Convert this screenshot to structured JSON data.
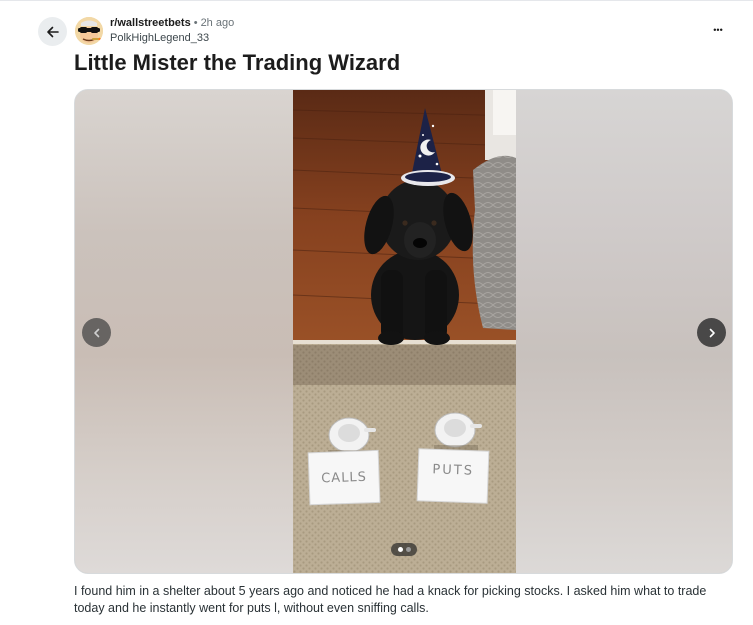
{
  "post": {
    "subreddit": "r/wallstreetbets",
    "separator": "•",
    "time_ago": "2h ago",
    "author": "PolkHighLegend_33",
    "title": "Little Mister the Trading Wizard",
    "more_label": "•••",
    "body": "I found him in a shelter about 5 years ago and noticed he had a knack for picking stocks. I asked him what to trade today and he instantly went for puts l, without even sniffing calls."
  },
  "gallery": {
    "total_images": 2,
    "current_index": 1,
    "cards": [
      {
        "text": "CALLS"
      },
      {
        "text": "PUTS"
      }
    ]
  },
  "icons": {
    "back": "arrow-left-icon",
    "more": "more-horizontal-icon",
    "prev": "chevron-left-icon",
    "next": "chevron-right-icon"
  },
  "colors": {
    "back_button_bg": "#eaedef",
    "text_primary": "#1c1c1c",
    "text_meta": "#6a7378",
    "floor_wood": "#7a3a1e",
    "rug": "#b9ab93"
  }
}
